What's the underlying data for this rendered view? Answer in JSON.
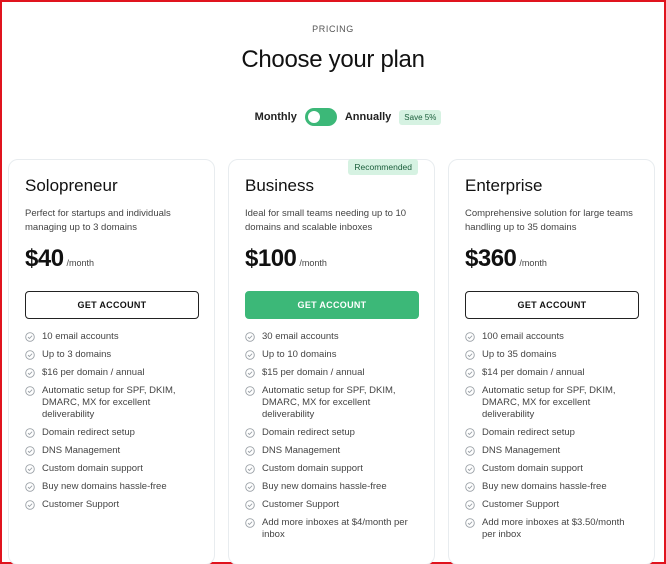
{
  "header": {
    "eyebrow": "PRICING",
    "title": "Choose your plan"
  },
  "billing": {
    "monthly_label": "Monthly",
    "annually_label": "Annually",
    "save_badge": "Save 5%"
  },
  "colors": {
    "accent": "#3cb878",
    "badge_bg": "#d6f2e2",
    "frame": "#e0141e"
  },
  "plans": [
    {
      "name": "Solopreneur",
      "description": "Perfect for startups and individuals managing up to 3 domains",
      "price": "$40",
      "period": "/month",
      "cta": "GET ACCOUNT",
      "features": [
        "10 email accounts",
        "Up to 3 domains",
        "$16 per domain / annual",
        "Automatic setup for SPF, DKIM, DMARC, MX for excellent deliverability",
        "Domain redirect setup",
        "DNS Management",
        "Custom domain support",
        "Buy new domains hassle-free",
        "Customer Support"
      ]
    },
    {
      "name": "Business",
      "badge": "Recommended",
      "description": "Ideal for small teams needing up to 10 domains and scalable inboxes",
      "price": "$100",
      "period": "/month",
      "cta": "GET ACCOUNT",
      "features": [
        "30 email accounts",
        "Up to 10 domains",
        "$15 per domain / annual",
        "Automatic setup for SPF, DKIM, DMARC, MX for excellent deliverability",
        "Domain redirect setup",
        "DNS Management",
        "Custom domain support",
        "Buy new domains hassle-free",
        "Customer Support",
        "Add more inboxes at $4/month per inbox"
      ]
    },
    {
      "name": "Enterprise",
      "description": "Comprehensive solution for large teams handling up to 35 domains",
      "price": "$360",
      "period": "/month",
      "cta": "GET ACCOUNT",
      "features": [
        "100 email accounts",
        "Up to 35 domains",
        "$14 per domain / annual",
        "Automatic setup for SPF, DKIM, DMARC, MX for excellent deliverability",
        "Domain redirect setup",
        "DNS Management",
        "Custom domain support",
        "Buy new domains hassle-free",
        "Customer Support",
        "Add more inboxes at $3.50/month per inbox"
      ]
    }
  ]
}
